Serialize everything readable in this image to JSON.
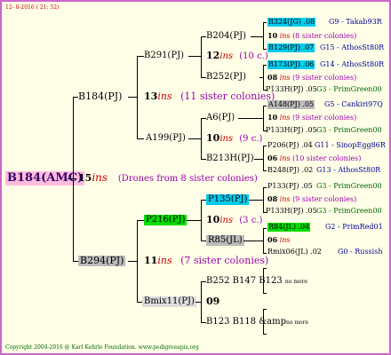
{
  "header": "12- 8-2016 ( 21: 52)",
  "footer": "Copyright 2004-2016 @ Karl Kehrle Foundation. www.pedigreeapis.org",
  "root": {
    "label": "B184(AMC)",
    "num": "15",
    "ins": "ins",
    "note": "(Drones from 8 sister colonies)"
  },
  "sire": {
    "label": "B184(PJ)",
    "num": "13",
    "ins": "ins",
    "note": "(11 sister colonies)"
  },
  "dam_side": {
    "label": "B294(PJ)",
    "num": "11",
    "ins": "ins",
    "note": "(7 sister colonies)"
  },
  "gen2": {
    "b291": {
      "label": "B291(PJ)",
      "num": "12",
      "ins": "ins",
      "note": "(10 c.)"
    },
    "a199": {
      "label": "A199(PJ)",
      "num": "10",
      "ins": "ins",
      "note": "(9 c.)"
    },
    "p216": {
      "label": "P216(PJ)",
      "num": "10",
      "ins": "ins",
      "note": "(3 c.)"
    },
    "bmix11": {
      "label": "Bmix11(PJ)",
      "num": "09"
    }
  },
  "gen3": {
    "b204": "B204(PJ)",
    "b252": "B252(PJ)",
    "a6": "A6(PJ)",
    "b213h": "B213H(PJ)",
    "p135": "P135(PJ)",
    "r85": "R85(JL)",
    "b252b147": "B252 B147 B123",
    "b252b147_note": "no more",
    "b123b118": "B123 B118 &amp",
    "b123b118_note": "no more"
  },
  "gen4": {
    "r1": {
      "label": "B324(JG) .08",
      "right": "G9 - Takab93R"
    },
    "r2": {
      "num": "10",
      "ins": "ins",
      "note": "(8 sister colonies)"
    },
    "r3": {
      "label": "B129(PJ) .07",
      "right": "G15 - AthosSt80R"
    },
    "r4": {
      "label": "B173(PJ) .06",
      "right": "G14 - AthosSt80R"
    },
    "r5": {
      "num": "08",
      "ins": "ins",
      "note": "(9 sister colonies)"
    },
    "r6": {
      "label": "P133H(PJ) .05",
      "right": "G3 - PrimGreen00"
    },
    "r7": {
      "label": "A148(PJ) .05",
      "right": "G5 - Cankiri97Q"
    },
    "r8": {
      "num": "10",
      "ins": "ins",
      "note": "(9 sister colonies)"
    },
    "r9": {
      "label": "P133H(PJ) .05",
      "right": "G3 - PrimGreen00"
    },
    "r10": {
      "label": "P206(PJ) .04",
      "right": "G11 - SinopEgg86R"
    },
    "r11": {
      "num": "06",
      "ins": "ins",
      "note": "(10 sister colonies)"
    },
    "r12": {
      "label": "B248(PJ) .02",
      "right": "G13 - AthosSt80R"
    },
    "r13": {
      "label": "P133(PJ) .05",
      "right": "G3 - PrimGreen00"
    },
    "r14": {
      "num": "08",
      "ins": "ins",
      "note": "(9 sister colonies)"
    },
    "r15": {
      "label": "P133H(PJ) .05",
      "right": "G3 - PrimGreen00"
    },
    "r16": {
      "label": "R84(JL) .04",
      "right": "G2 - PrimRed01"
    },
    "r17": {
      "num": "06",
      "ins": "ins"
    },
    "r18": {
      "label": "Rmix06(JL) .02",
      "right": "G0 - Russish"
    }
  }
}
